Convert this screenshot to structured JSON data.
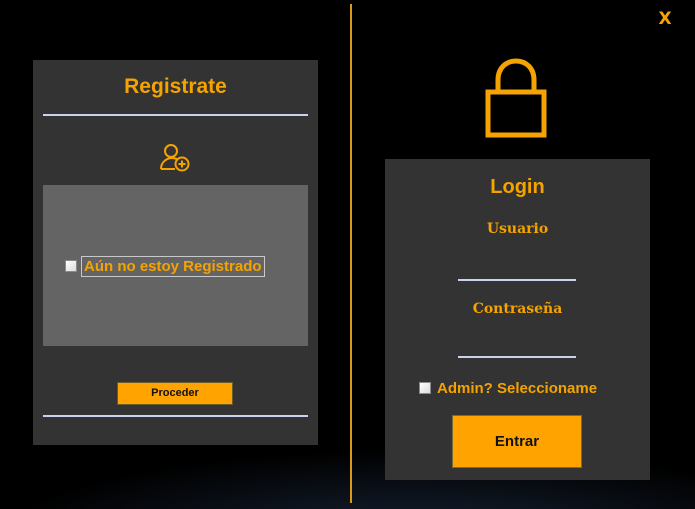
{
  "window": {
    "close_label": "X"
  },
  "register": {
    "title": "Registrate",
    "icon": "add-user-icon",
    "checkbox_label": "Aún no estoy Registrado",
    "checkbox_checked": false,
    "proceed_label": "Proceder"
  },
  "login": {
    "icon": "lock-icon",
    "title": "Login",
    "user_label": "Usuario",
    "user_value": "",
    "password_label": "Contraseña",
    "password_value": "",
    "admin_label": "Admin? Seleccioname",
    "admin_checked": false,
    "enter_label": "Entrar"
  },
  "colors": {
    "accent": "#f5a300",
    "button": "#ffa300",
    "panel": "#333333",
    "inner_box": "#646464",
    "background": "#000000",
    "divider": "#d99a17",
    "rule": "#c9d2ec"
  }
}
